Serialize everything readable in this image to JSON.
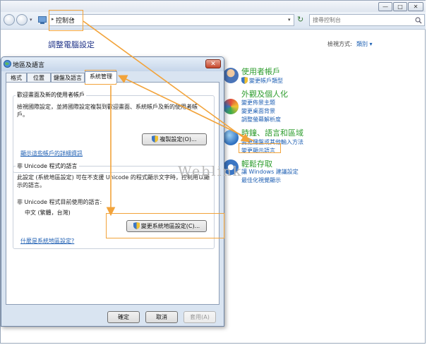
{
  "window": {
    "minimize": "—",
    "maximize": "□",
    "close": "✕"
  },
  "address_bar": {
    "breadcrumb": "控制台",
    "search_placeholder": "搜尋控制台"
  },
  "control_panel": {
    "heading": "調整電腦設定",
    "view_by_label": "檢視方式:",
    "view_by_value": "類別 ▾",
    "categories": [
      {
        "title": "使用者帳戶",
        "links": [
          "變更帳戶類型"
        ]
      },
      {
        "title": "外觀及個人化",
        "links": [
          "變更佈景主題",
          "變更桌面背景",
          "調整螢幕解析度"
        ]
      },
      {
        "title": "時鐘、語言和區域",
        "links": [
          "變更鍵盤或其他輸入方法",
          "變更顯示語言"
        ]
      },
      {
        "title": "輕鬆存取",
        "links": [
          "讓 Windows 建議設定",
          "最佳化視覺顯示"
        ]
      }
    ]
  },
  "dialog": {
    "title": "地區及語言",
    "tabs": [
      "格式",
      "位置",
      "鍵盤及語言",
      "系統管理"
    ],
    "welcome_group": {
      "label": "歡迎畫面及新的使用者帳戶",
      "text": "檢視國際設定，並將國際設定複製到歡迎畫面、系統帳戶及新的使用者帳戶。",
      "copy_button": "複製設定(O)...",
      "link": "顯示這些帳戶的詳細資訊"
    },
    "unicode_group": {
      "label": "非 Unicode 程式的語言",
      "text": "此設定 (系統地區設定) 可在不支援 Unicode 的程式顯示文字時，控制用以顯示的語言。",
      "current_label": "非 Unicode 程式目前使用的語言:",
      "current_value": "中文 (繁體，台灣)",
      "change_button": "變更系統地區設定(C)...",
      "link": "什麼是系統地區設定?"
    },
    "buttons": {
      "ok": "確定",
      "cancel": "取消",
      "apply": "套用(A)"
    }
  },
  "watermark": "Weblink",
  "colors": {
    "annotation": "#f2a33a",
    "link": "#1e5fb3",
    "category_title": "#2f9d2f"
  }
}
